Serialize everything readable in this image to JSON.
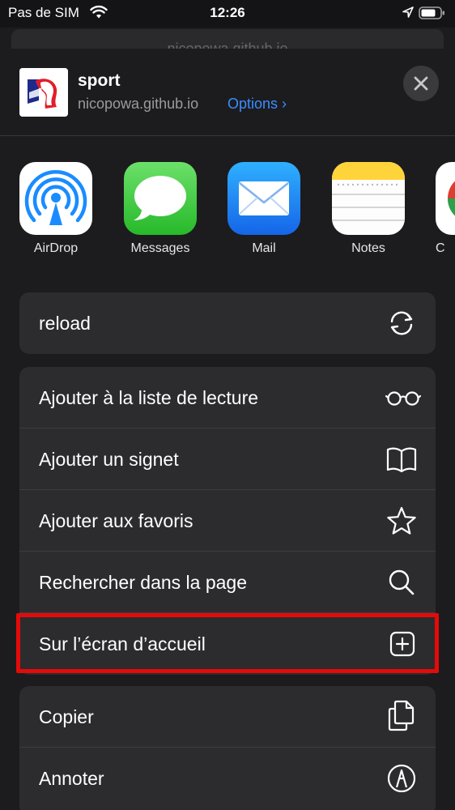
{
  "status_bar": {
    "carrier": "Pas de SIM",
    "time": "12:26"
  },
  "behind": {
    "url": "nicopowa.github.io"
  },
  "header": {
    "title": "sport",
    "url": "nicopowa.github.io",
    "options_label": "Options ›"
  },
  "apps": [
    {
      "label": "AirDrop",
      "icon": "airdrop-icon"
    },
    {
      "label": "Messages",
      "icon": "messages-icon"
    },
    {
      "label": "Mail",
      "icon": "mail-icon"
    },
    {
      "label": "Notes",
      "icon": "notes-icon"
    },
    {
      "label": "C",
      "icon": "chrome-icon"
    }
  ],
  "actions_top": [
    {
      "label": "reload",
      "icon": "reload-icon"
    }
  ],
  "actions_main": [
    {
      "label": "Ajouter à la liste de lecture",
      "icon": "glasses-icon"
    },
    {
      "label": "Ajouter un signet",
      "icon": "book-icon"
    },
    {
      "label": "Ajouter aux favoris",
      "icon": "star-icon"
    },
    {
      "label": "Rechercher dans la page",
      "icon": "search-icon"
    },
    {
      "label": "Sur l’écran d’accueil",
      "icon": "add-square-icon"
    }
  ],
  "actions_bottom": [
    {
      "label": "Copier",
      "icon": "copy-icon"
    },
    {
      "label": "Annoter",
      "icon": "markup-icon"
    }
  ],
  "colors": {
    "accent": "#3b8cff",
    "highlight": "#e40a0a",
    "sheet": "#1c1c1e",
    "cell": "#2c2c2e"
  }
}
